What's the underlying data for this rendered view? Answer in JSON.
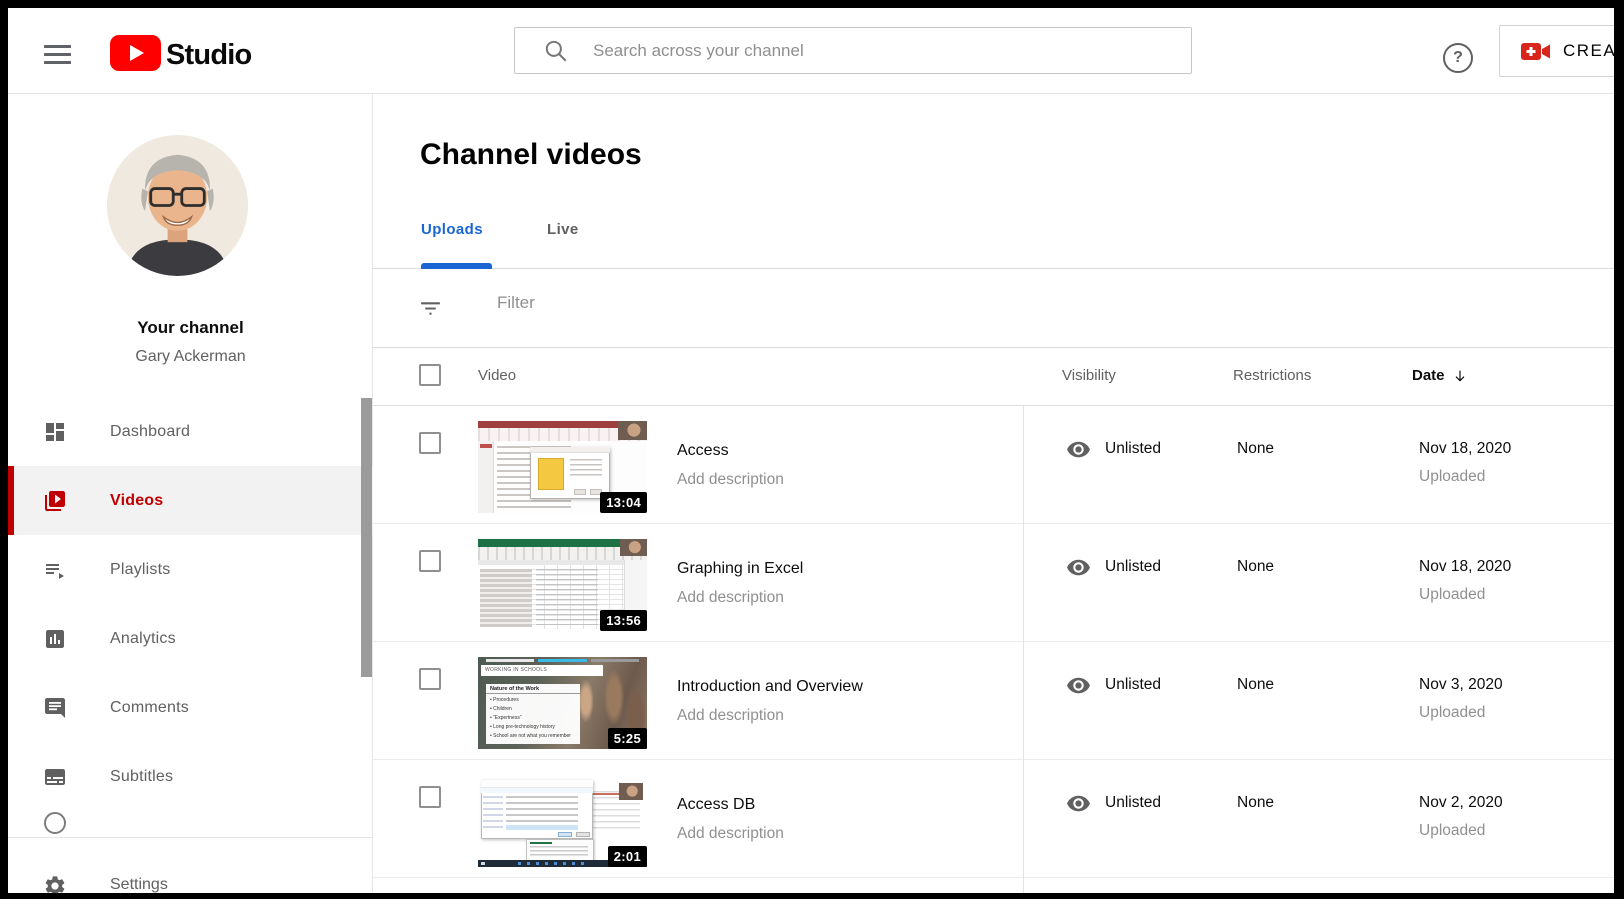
{
  "colors": {
    "brand_red": "#ff0000",
    "accent_red": "#c00000",
    "active_tab_blue": "#1966d2",
    "selected_item_bg": "#f2f2f2",
    "duration_badge_bg": "#000000"
  },
  "topbar": {
    "brand": "Studio",
    "search_placeholder": "Search across your channel",
    "help_glyph": "?",
    "create_label": "CREATE"
  },
  "sidebar": {
    "channel_title": "Your channel",
    "channel_name": "Gary Ackerman",
    "items": [
      {
        "label": "Dashboard",
        "active": false
      },
      {
        "label": "Videos",
        "active": true
      },
      {
        "label": "Playlists",
        "active": false
      },
      {
        "label": "Analytics",
        "active": false
      },
      {
        "label": "Comments",
        "active": false
      },
      {
        "label": "Subtitles",
        "active": false
      }
    ],
    "settings_label": "Settings"
  },
  "main": {
    "title": "Channel videos",
    "tabs": [
      {
        "label": "Uploads",
        "active": true
      },
      {
        "label": "Live",
        "active": false
      }
    ],
    "filter_placeholder": "Filter",
    "table": {
      "columns": [
        "Video",
        "Visibility",
        "Restrictions",
        "Date"
      ],
      "sort": {
        "column": "Date",
        "direction": "descending"
      },
      "rows": [
        {
          "title": "Access",
          "description_placeholder": "Add description",
          "duration": "13:04",
          "visibility": "Unlisted",
          "restrictions": "None",
          "date": "Nov 18, 2020",
          "date_sub": "Uploaded"
        },
        {
          "title": "Graphing in Excel",
          "description_placeholder": "Add description",
          "duration": "13:56",
          "visibility": "Unlisted",
          "restrictions": "None",
          "date": "Nov 18, 2020",
          "date_sub": "Uploaded"
        },
        {
          "title": "Introduction and Overview",
          "description_placeholder": "Add description",
          "duration": "5:25",
          "visibility": "Unlisted",
          "restrictions": "None",
          "date": "Nov 3, 2020",
          "date_sub": "Uploaded",
          "thumbnail_text": {
            "top_label": "WORKING IN SCHOOLS",
            "box_title": "Nature of the Work",
            "bullets": [
              "Procedures",
              "Children",
              "“Expertness”",
              "Long pre-technology history",
              "School are not what you remember"
            ]
          }
        },
        {
          "title": "Access DB",
          "description_placeholder": "Add description",
          "duration": "2:01",
          "visibility": "Unlisted",
          "restrictions": "None",
          "date": "Nov 2, 2020",
          "date_sub": "Uploaded"
        }
      ]
    }
  }
}
